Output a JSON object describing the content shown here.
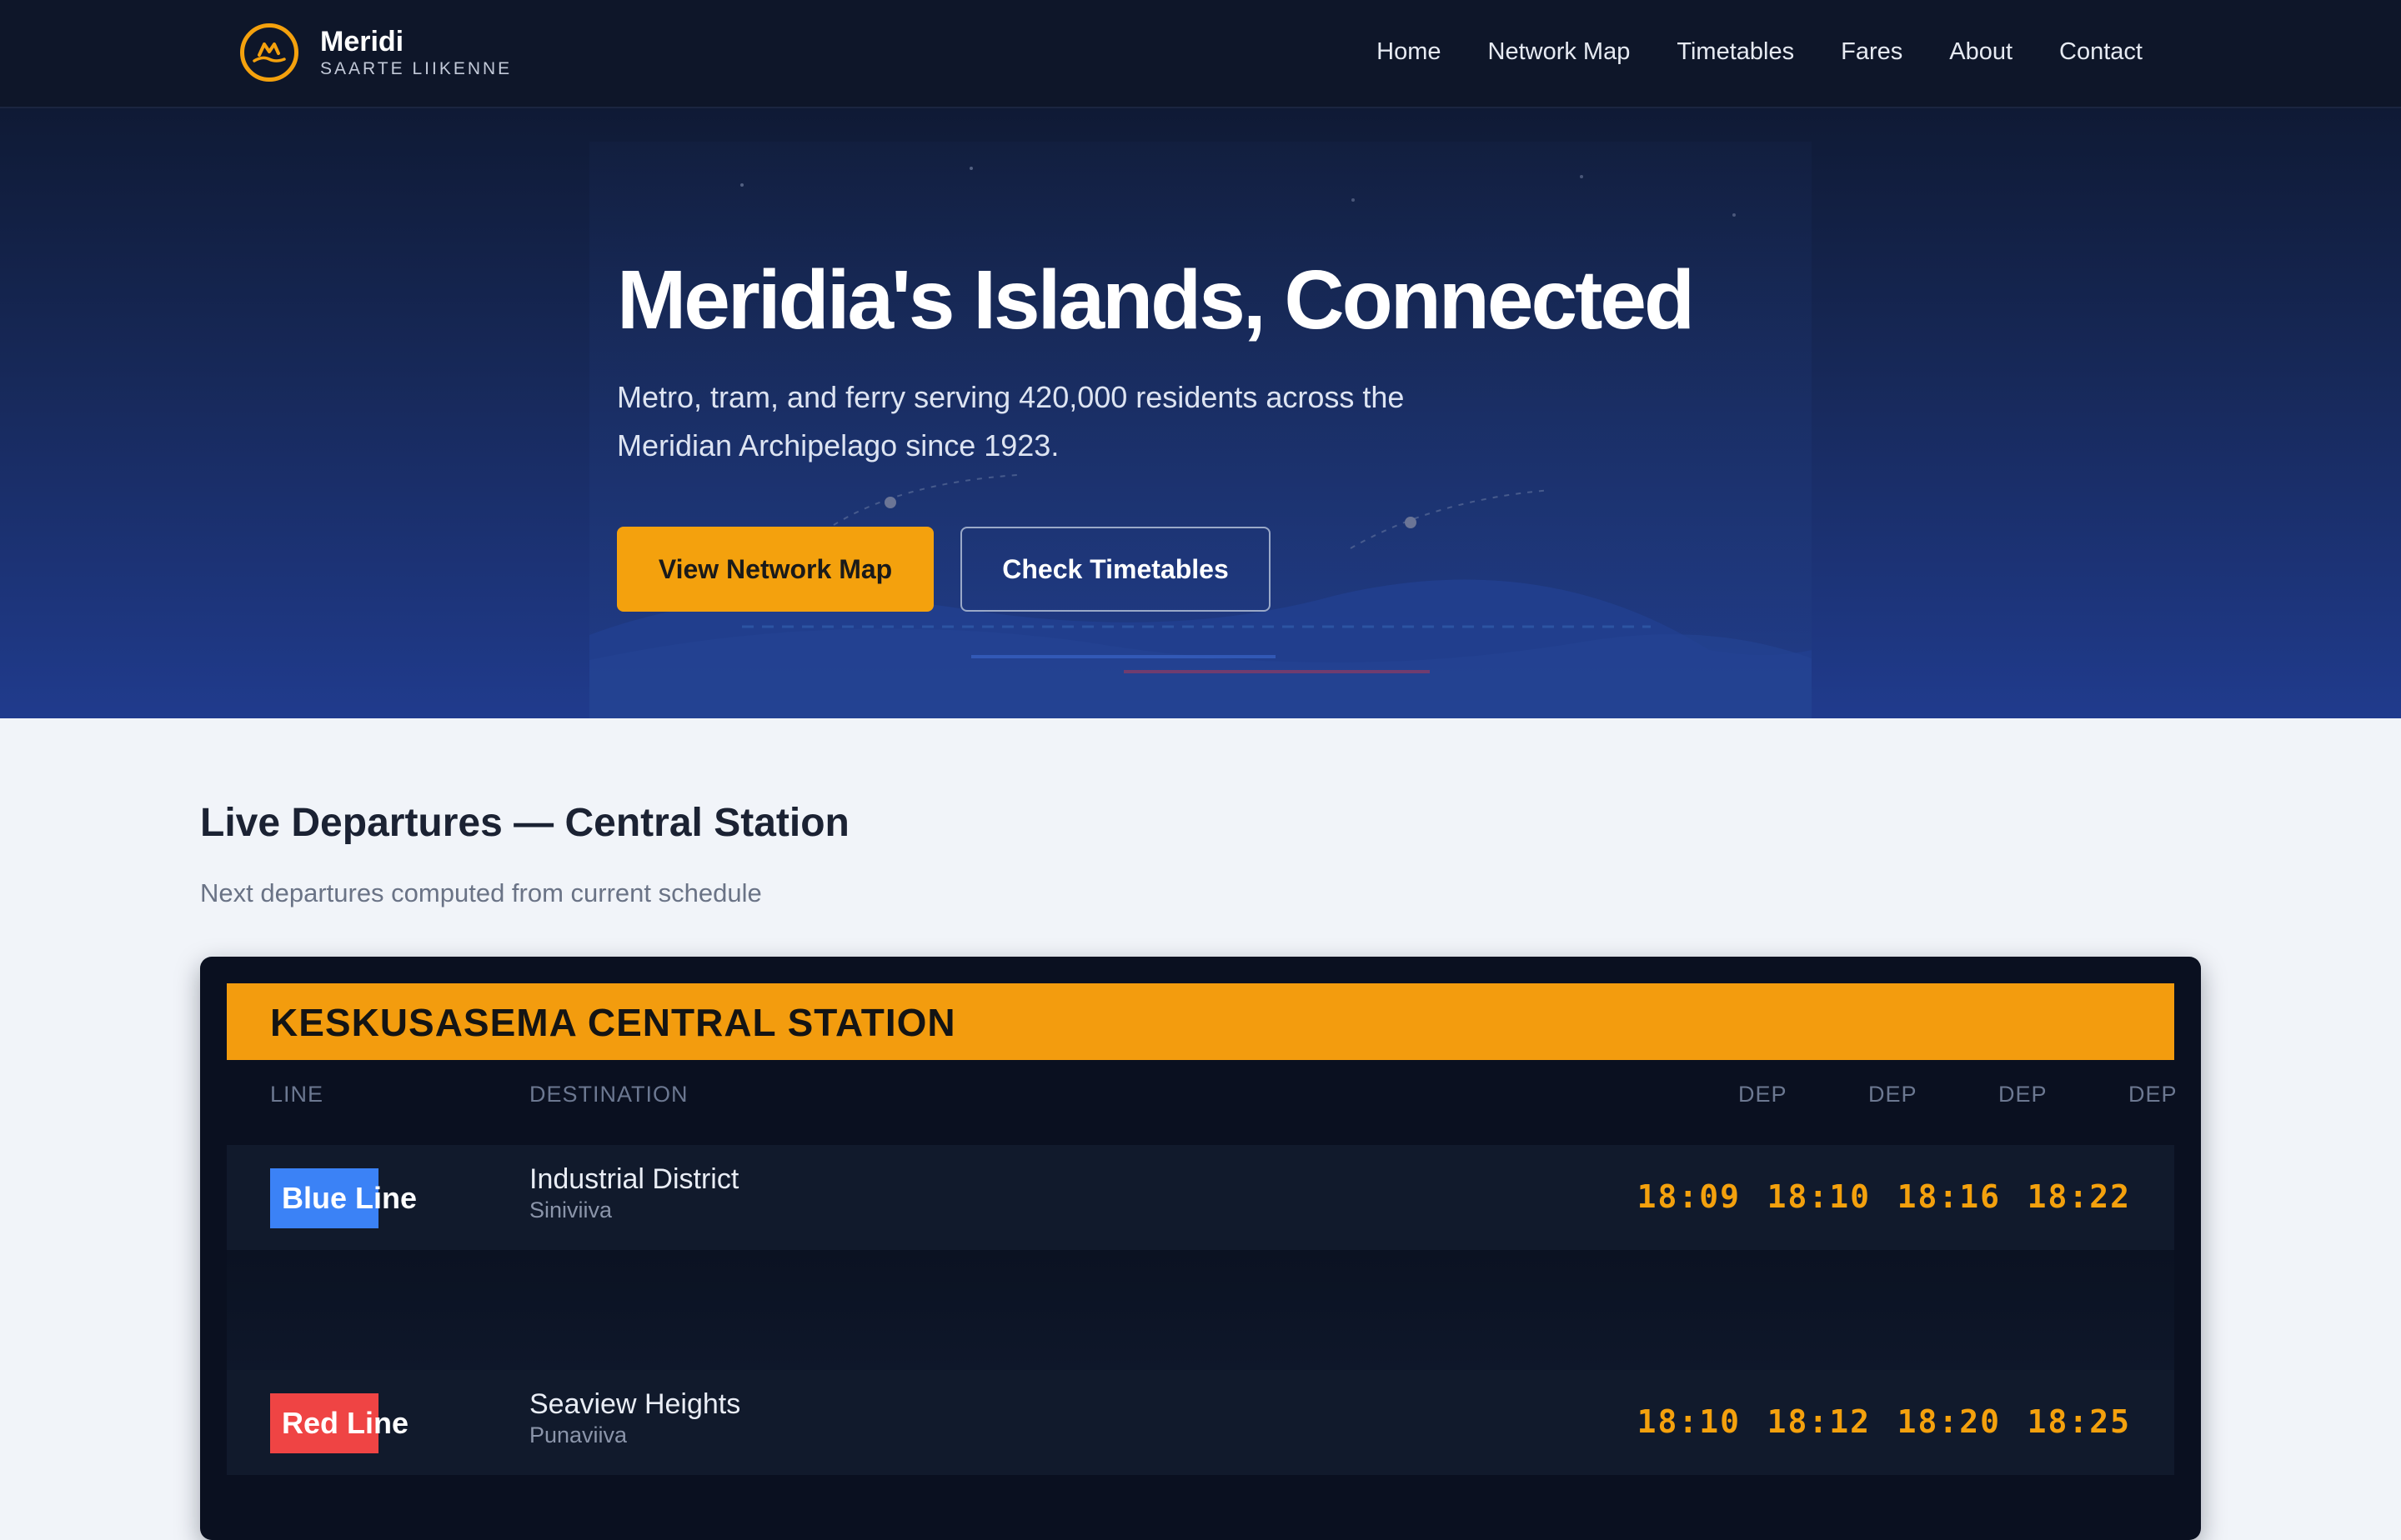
{
  "header": {
    "brand_name": "Meridi",
    "brand_sub": "SAARTE LIIKENNE",
    "nav": [
      "Home",
      "Network Map",
      "Timetables",
      "Fares",
      "About",
      "Contact"
    ]
  },
  "hero": {
    "title": "Meridia's Islands, Connected",
    "lead": "Metro, tram, and ferry serving 420,000 residents across the Meridian Archipelago since 1923.",
    "primary_button": "View Network Map",
    "secondary_button": "Check Timetables"
  },
  "departures": {
    "title": "Live Departures — Central Station",
    "subtitle": "Next departures computed from current schedule",
    "board_title": "KESKUSASEMA  CENTRAL STATION",
    "columns": {
      "line": "LINE",
      "destination": "DESTINATION",
      "dep": [
        "DEP",
        "DEP",
        "DEP",
        "DEP"
      ]
    },
    "rows": [
      {
        "line": "Blue Line",
        "line_color": "#3b82f6",
        "destination": "Industrial District",
        "destination_local": "Siniviiva",
        "times": [
          "18:09",
          "18:10",
          "18:16",
          "18:22"
        ]
      },
      {
        "line": "Red Line",
        "line_color": "#ef4444",
        "destination": "Seaview Heights",
        "destination_local": "Punaviiva",
        "times": [
          "18:10",
          "18:12",
          "18:20",
          "18:25"
        ]
      }
    ]
  },
  "colors": {
    "accent": "#f4a10d",
    "header_bg": "#0e1629",
    "hero_bottom": "#203b8d",
    "board_bg": "#0a1020"
  },
  "icons": {
    "logo": "mountain-wave-logo-icon"
  }
}
